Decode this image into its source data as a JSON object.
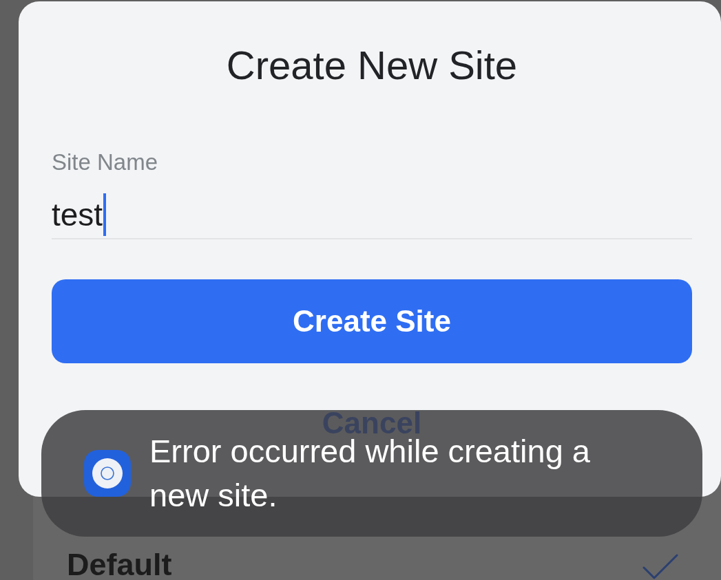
{
  "background": {
    "list_items": [
      {
        "label": "Default",
        "selected": true
      }
    ]
  },
  "dialog": {
    "title": "Create New Site",
    "field": {
      "label": "Site Name",
      "value": "test",
      "focused": true
    },
    "create_button": "Create Site",
    "cancel_button": "Cancel"
  },
  "toast": {
    "message": "Error occurred while creating a new site."
  }
}
